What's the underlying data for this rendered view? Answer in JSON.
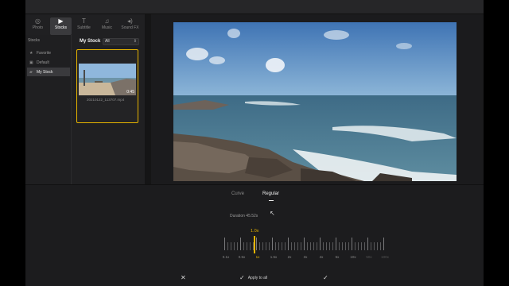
{
  "media_tabs": [
    {
      "label": "Photo",
      "icon": "◎"
    },
    {
      "label": "Stocks",
      "icon": "▶"
    },
    {
      "label": "Subtitle",
      "icon": "T"
    },
    {
      "label": "Music",
      "icon": "♫"
    },
    {
      "label": "Sound FX",
      "icon": "◂)"
    }
  ],
  "sidebar": {
    "heading": "Stocks",
    "items": [
      {
        "label": "Favorite",
        "icon": "★"
      },
      {
        "label": "Default",
        "icon": "▣"
      },
      {
        "label": "My Stock",
        "icon": "▰"
      }
    ]
  },
  "stock": {
    "title": "My Stock",
    "filter_value": "All",
    "clip": {
      "name": "20210122_113707.mp4",
      "duration": "0:45"
    }
  },
  "speed_panel": {
    "tabs": {
      "curve": "Curve",
      "regular": "Regular"
    },
    "duration": "Duration 45.52s",
    "current_speed": "1.0x",
    "scale": [
      "0.1x",
      "0.5x",
      "1x",
      "1.5x",
      "2x",
      "3x",
      "4x",
      "5x",
      "10x",
      "50x",
      "100x"
    ],
    "apply_all": "Apply to all",
    "accent": "#e6b400"
  }
}
